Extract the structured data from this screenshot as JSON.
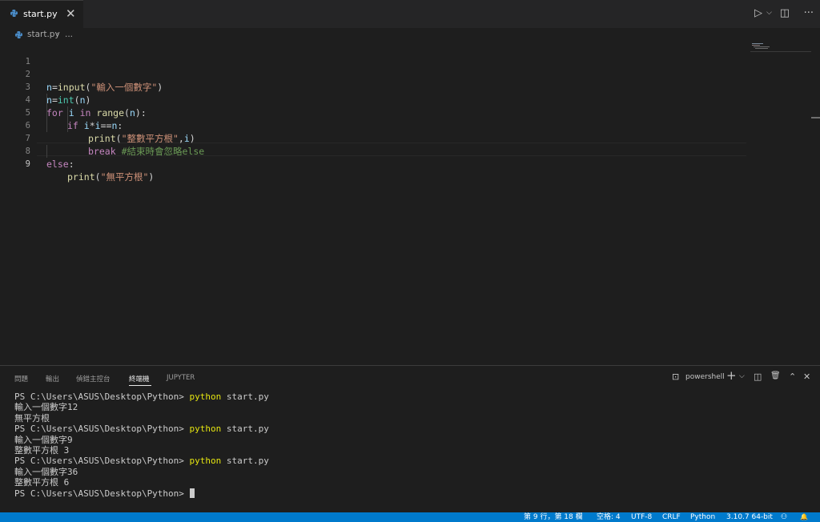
{
  "tab": {
    "filename": "start.py",
    "close": "✕"
  },
  "actions": {
    "run": "▷",
    "run_menu": "⌵",
    "split": "◫",
    "more": "···"
  },
  "breadcrumb": {
    "file": "start.py",
    "sep": "›",
    "more": "..."
  },
  "editor": {
    "active_line": 9,
    "lines": [
      {
        "n": "1"
      },
      {
        "n": "2"
      },
      {
        "n": "3"
      },
      {
        "n": "4"
      },
      {
        "n": "5"
      },
      {
        "n": "6"
      },
      {
        "n": "7"
      },
      {
        "n": "8"
      },
      {
        "n": "9"
      }
    ],
    "code": {
      "l2": {
        "a": "n",
        "b": "=",
        "c": "input",
        "d": "(",
        "e": "\"輸入一個數字\"",
        "f": ")"
      },
      "l3": {
        "a": "n",
        "b": "=",
        "c": "int",
        "d": "(",
        "e": "n",
        "f": ")"
      },
      "l4": {
        "a": "for",
        "b": " ",
        "c": "i",
        "d": " ",
        "e": "in",
        "f": " ",
        "g": "range",
        "h": "(",
        "i": "n",
        "j": "):"
      },
      "l5": {
        "a": "if",
        "b": " ",
        "c": "i",
        "d": "*",
        "e": "i",
        "f": "==",
        "g": "n",
        "h": ":"
      },
      "l6": {
        "a": "print",
        "b": "(",
        "c": "\"整數平方根\"",
        "d": ",",
        "e": "i",
        "f": ")"
      },
      "l7": {
        "a": "break",
        "b": " ",
        "c": "#結束時會忽略else"
      },
      "l8": {
        "a": "else",
        "b": ":"
      },
      "l9": {
        "a": "print",
        "b": "(",
        "c": "\"無平方根\"",
        "d": ")"
      }
    }
  },
  "panel": {
    "tabs": [
      "問題",
      "輸出",
      "偵錯主控台",
      "終端機",
      "JUPYTER"
    ],
    "active_tab": "終端機",
    "shell_icon": "⊡",
    "shell": "powershell",
    "tools": {
      "add": "+",
      "dropdown": "⌵",
      "split": "◫",
      "trash": "🗑",
      "maximize": "⌃",
      "close": "✕"
    },
    "terminal": [
      {
        "prompt": "PS C:\\Users\\ASUS\\Desktop\\Python> ",
        "cmd": "python",
        "rest": " start.py"
      },
      {
        "text": "輸入一個數字12"
      },
      {
        "text": "無平方根"
      },
      {
        "prompt": "PS C:\\Users\\ASUS\\Desktop\\Python> ",
        "cmd": "python",
        "rest": " start.py"
      },
      {
        "text": "輸入一個數字9"
      },
      {
        "text": "整數平方根 3"
      },
      {
        "prompt": "PS C:\\Users\\ASUS\\Desktop\\Python> ",
        "cmd": "python",
        "rest": " start.py"
      },
      {
        "text": "輸入一個數字36"
      },
      {
        "text": "整數平方根 6"
      },
      {
        "prompt": "PS C:\\Users\\ASUS\\Desktop\\Python> ",
        "cmd": "",
        "rest": ""
      }
    ]
  },
  "status": {
    "position": "第 9 行，第 18 欄",
    "spaces": "空格: 4",
    "encoding": "UTF-8",
    "eol": "CRLF",
    "language": "Python",
    "interpreter": "3.10.7 64-bit",
    "account_icon": "⚇",
    "bell_icon": "🔔"
  },
  "colors": {
    "accent": "#007acc",
    "editor_bg": "#1e1e1e",
    "tab_bar_bg": "#252526"
  }
}
